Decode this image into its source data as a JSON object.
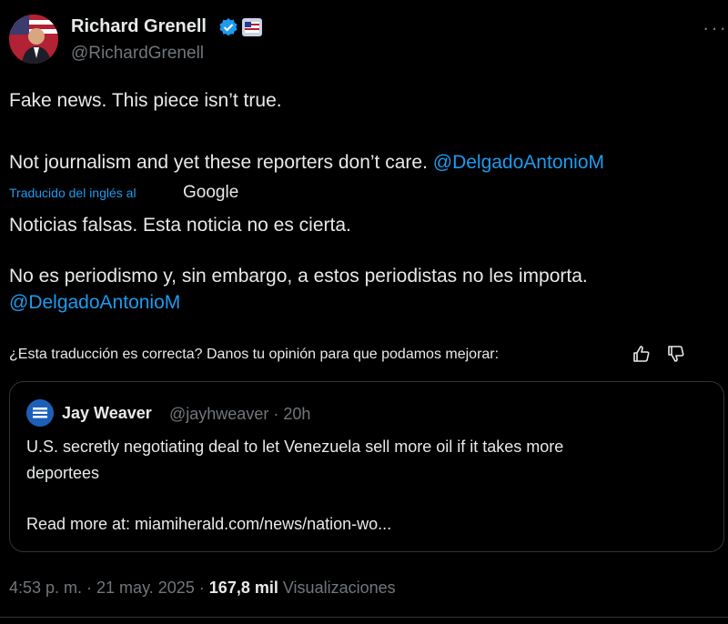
{
  "author": {
    "name": "Richard Grenell",
    "handle": "@RichardGrenell"
  },
  "tweet": {
    "line1": "Fake news. This piece isn’t true.",
    "line2": "Not journalism and yet these reporters don’t care.",
    "line2_mention": "@DelgadoAntonioM"
  },
  "translation": {
    "label": "Traducido del inglés al",
    "provider": "Google",
    "line1": "Noticias falsas. Esta noticia no es cierta.",
    "line2": "No es periodismo y, sin embargo, a estos periodistas no les importa.",
    "line2_mention": "@DelgadoAntonioM",
    "feedback": "¿Esta traducción es correcta? Danos tu opinión para que podamos mejorar:"
  },
  "quote": {
    "author_name": "Jay Weaver",
    "handle_time": "@jayhweaver · 20h",
    "text_line1": "U.S. secretly negotiating deal to let Venezuela sell more oil if it takes more",
    "text_line2": "deportees",
    "read_more": "Read more at: miamiherald.com/news/nation-wo..."
  },
  "footer": {
    "time_date": "4:53 p. m. · 21 may. 2025 ·",
    "views_count": "167,8 mil",
    "views_label": "Visualizaciones"
  },
  "colors": {
    "accent": "#1d9bf0",
    "background": "#000000",
    "secondary_text": "#71767b"
  },
  "icons": [
    "verified-badge-icon",
    "affiliation-flag-icon",
    "more-options-icon",
    "thumbs-up-icon",
    "thumbs-down-icon"
  ]
}
